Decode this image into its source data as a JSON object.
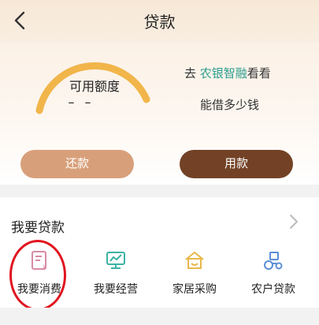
{
  "header": {
    "title": "贷款",
    "back_icon": "chevron-left-icon"
  },
  "quota": {
    "label": "可用额度",
    "value": "– –"
  },
  "promo": {
    "prefix": "去 ",
    "brand": "农银智融",
    "suffix": "看看",
    "line2": "能借多少钱"
  },
  "buttons": {
    "repay": "还款",
    "use": "用款"
  },
  "section": {
    "title": "我要贷款",
    "items": [
      {
        "label": "我要消费",
        "icon": "consumption-bill-icon"
      },
      {
        "label": "我要经营",
        "icon": "business-chart-icon"
      },
      {
        "label": "家居采购",
        "icon": "home-purchase-icon"
      },
      {
        "label": "农户贷款",
        "icon": "farm-tractor-icon"
      }
    ]
  },
  "colors": {
    "brand_green": "#2a9c8d",
    "repay_btn": "#d8a07a",
    "use_btn": "#734226",
    "gauge": "#f1b54a",
    "highlight_circle": "#e0141e"
  }
}
